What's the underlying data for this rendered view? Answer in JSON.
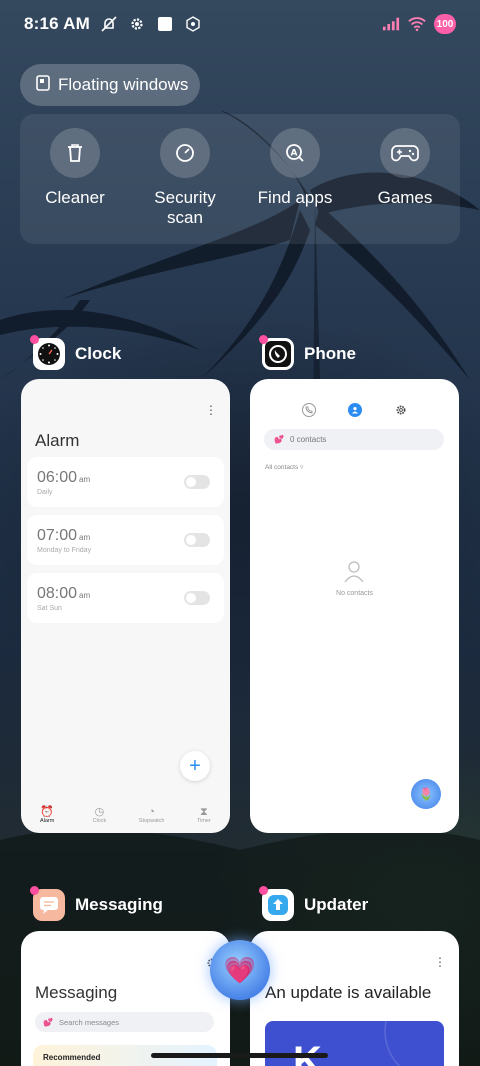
{
  "status_bar": {
    "time": "8:16 AM",
    "battery": "100",
    "icons": [
      "do-not-disturb-icon",
      "settings-gear-icon",
      "square-notification-icon",
      "hexagon-app-icon",
      "signal-icon",
      "wifi-icon"
    ]
  },
  "floating_windows": {
    "label": "Floating windows",
    "icon": "floating-window-icon"
  },
  "quick_actions": [
    {
      "label": "Cleaner",
      "icon": "trash-icon"
    },
    {
      "label": "Security\nscan",
      "icon": "gauge-icon"
    },
    {
      "label": "Find apps",
      "icon": "search-apps-icon"
    },
    {
      "label": "Games",
      "icon": "gamepad-icon"
    }
  ],
  "apps": {
    "clock": {
      "name": "Clock",
      "title": "Alarm",
      "alarms": [
        {
          "time": "06:00",
          "period": "am",
          "repeat": "Daily"
        },
        {
          "time": "07:00",
          "period": "am",
          "repeat": "Monday to Friday"
        },
        {
          "time": "08:00",
          "period": "am",
          "repeat": "Sat Sun"
        }
      ],
      "fab": "+",
      "nav": [
        "Alarm",
        "Clock",
        "Stopwatch",
        "Timer"
      ]
    },
    "phone": {
      "name": "Phone",
      "search": "0 contacts",
      "filter": "All contacts",
      "empty": "No contacts"
    },
    "messaging": {
      "name": "Messaging",
      "title": "Messaging",
      "search_placeholder": "Search messages",
      "recommended": "Recommended"
    },
    "updater": {
      "name": "Updater",
      "title": "An update is available",
      "banner_letter": "K"
    }
  },
  "colors": {
    "accent_blue": "#2b8cf2",
    "heart_pink": "#ff4fa0",
    "banner_blue": "#3e4fd0"
  }
}
